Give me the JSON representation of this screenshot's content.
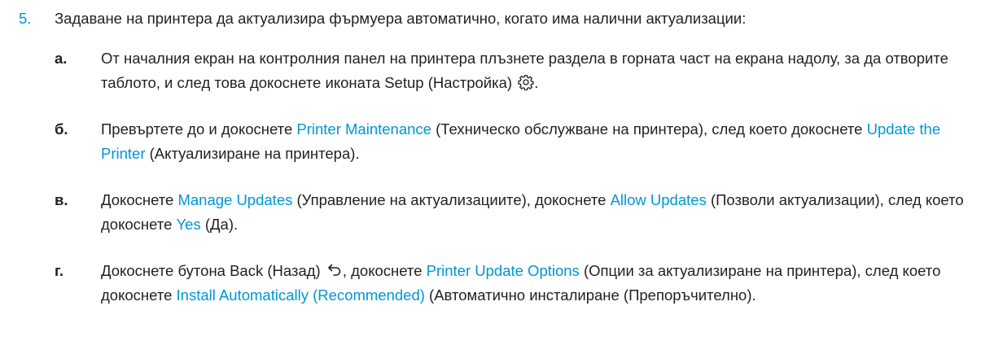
{
  "step": {
    "number": "5.",
    "text": "Задаване на принтера да актуализира фърмуера автоматично, когато има налични актуализации:"
  },
  "substeps": [
    {
      "letter": "а.",
      "t1": "От началния екран на контролния панел на принтера плъзнете раздела в горната част на екрана надолу, за да отворите таблото, и след това докоснете иконата Setup (Настройка)",
      "icon": "gear-icon",
      "t2": "."
    },
    {
      "letter": "б.",
      "t1": "Превъртете до и докоснете ",
      "link1": "Printer Maintenance",
      "t2": " (Техническо обслужване на принтера), след което докоснете ",
      "link2": "Update the Printer",
      "t3": " (Актуализиране на принтера)."
    },
    {
      "letter": "в.",
      "t1": "Докоснете ",
      "link1": "Manage Updates",
      "t2": " (Управление на актуализациите), докоснете ",
      "link2": "Allow Updates",
      "t3": " (Позволи актуализации), след което докоснете ",
      "link3": "Yes",
      "t4": " (Да)."
    },
    {
      "letter": "г.",
      "t1": "Докоснете бутона Back (Назад)",
      "icon": "back-arrow-icon",
      "t2": ", докоснете ",
      "link1": "Printer Update Options",
      "t3": " (Опции за актуализиране на принтера), след което докоснете ",
      "link2": "Install Automatically (Recommended)",
      "t4": " (Автоматично инсталиране (Препоръчително)."
    }
  ],
  "colors": {
    "accent": "#0096d6",
    "text": "#231f20"
  }
}
